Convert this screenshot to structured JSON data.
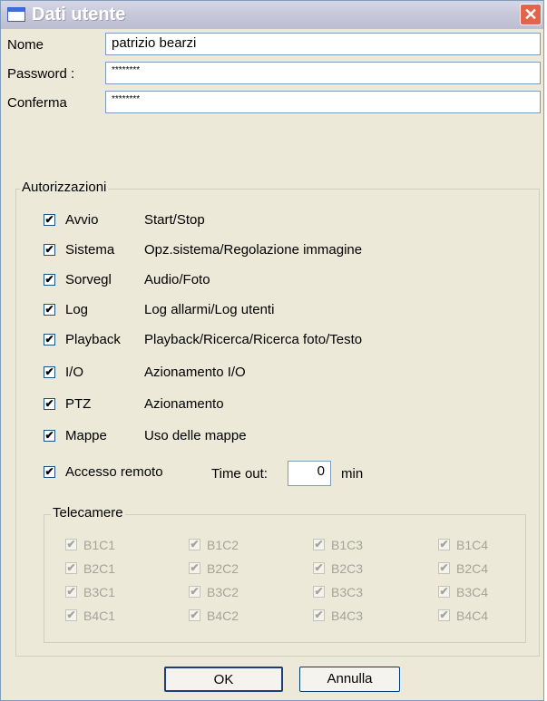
{
  "window": {
    "title": "Dati utente",
    "close_symbol": "✕"
  },
  "fields": {
    "nome": {
      "label": "Nome",
      "value": "patrizio bearzi"
    },
    "password": {
      "label": "Password :",
      "value": "********"
    },
    "conferma": {
      "label": "Conferma",
      "value": "********"
    }
  },
  "autorizzazioni": {
    "legend": "Autorizzazioni",
    "items": [
      {
        "name": "Avvio",
        "desc": "Start/Stop",
        "checked": true
      },
      {
        "name": "Sistema",
        "desc": "Opz.sistema/Regolazione immagine",
        "checked": true
      },
      {
        "name": "Sorvegl",
        "desc": "Audio/Foto",
        "checked": true
      },
      {
        "name": "Log",
        "desc": "Log allarmi/Log utenti",
        "checked": true
      },
      {
        "name": "Playback",
        "desc": "Playback/Ricerca/Ricerca foto/Testo",
        "checked": true
      },
      {
        "name": "I/O",
        "desc": "Azionamento I/O",
        "checked": true
      },
      {
        "name": "PTZ",
        "desc": "Azionamento",
        "checked": true
      },
      {
        "name": "Mappe",
        "desc": "Uso delle mappe",
        "checked": true
      }
    ],
    "remote": {
      "name": "Accesso remoto",
      "checked": true,
      "timeout_label": "Time out:",
      "timeout_value": "0",
      "unit": "min"
    }
  },
  "telecamere": {
    "legend": "Telecamere",
    "cameras": [
      {
        "label": "B1C1",
        "checked": true
      },
      {
        "label": "B1C2",
        "checked": true
      },
      {
        "label": "B1C3",
        "checked": true
      },
      {
        "label": "B1C4",
        "checked": true
      },
      {
        "label": "B2C1",
        "checked": true
      },
      {
        "label": "B2C2",
        "checked": true
      },
      {
        "label": "B2C3",
        "checked": true
      },
      {
        "label": "B2C4",
        "checked": true
      },
      {
        "label": "B3C1",
        "checked": true
      },
      {
        "label": "B3C2",
        "checked": true
      },
      {
        "label": "B3C3",
        "checked": true
      },
      {
        "label": "B3C4",
        "checked": true
      },
      {
        "label": "B4C1",
        "checked": true
      },
      {
        "label": "B4C2",
        "checked": true
      },
      {
        "label": "B4C3",
        "checked": true
      },
      {
        "label": "B4C4",
        "checked": true
      }
    ]
  },
  "buttons": {
    "ok": "OK",
    "cancel": "Annulla"
  },
  "check_symbol": "✔"
}
